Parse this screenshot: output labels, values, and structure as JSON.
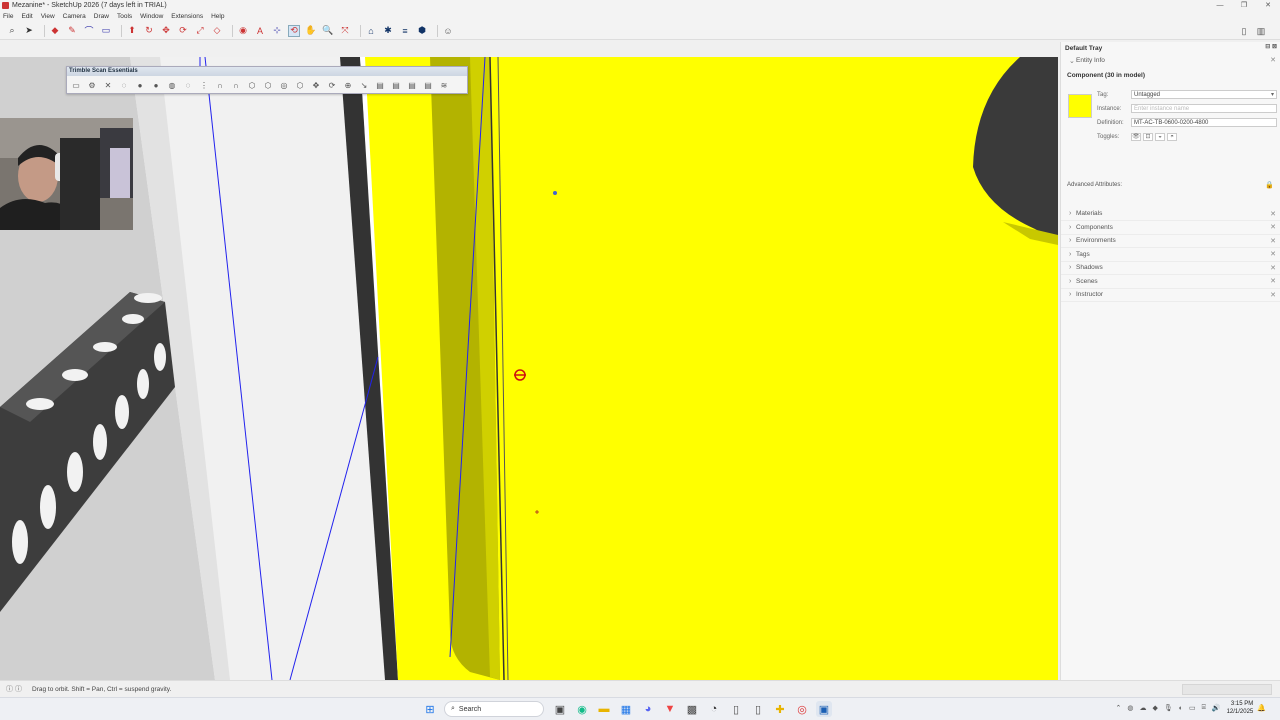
{
  "window": {
    "title": "Mezanine* - SketchUp 2026 (7 days left in TRIAL)",
    "controls": [
      "—",
      "❐",
      "✕"
    ]
  },
  "menu": [
    "File",
    "Edit",
    "View",
    "Camera",
    "Draw",
    "Tools",
    "Window",
    "Extensions",
    "Help"
  ],
  "floating_toolbar": {
    "title": "Trimble Scan Essentials"
  },
  "tray": {
    "title": "Default Tray",
    "entity_info": {
      "section_label": "Entity Info",
      "heading": "Component (30 in model)",
      "tag_label": "Tag:",
      "tag_value": "Untagged",
      "instance_label": "Instance:",
      "instance_placeholder": "Enter instance name",
      "definition_label": "Definition:",
      "definition_value": "MT-AC-TB-0600-0200-4800",
      "toggles_label": "Toggles:",
      "advanced_label": "Advanced Attributes:",
      "swatch_color": "#ffff00"
    },
    "sections": [
      "Materials",
      "Components",
      "Environments",
      "Tags",
      "Shadows",
      "Scenes",
      "Instructor"
    ]
  },
  "status": {
    "text": "Drag to orbit. Shift = Pan, Ctrl = suspend gravity."
  },
  "taskbar": {
    "search_label": "Search",
    "time": "3:15 PM",
    "date": "12/1/2025"
  },
  "colors": {
    "face_yellow": "#ffff00",
    "back_face_yellow": "#b8b800",
    "selection_blue": "#1a1aff"
  }
}
